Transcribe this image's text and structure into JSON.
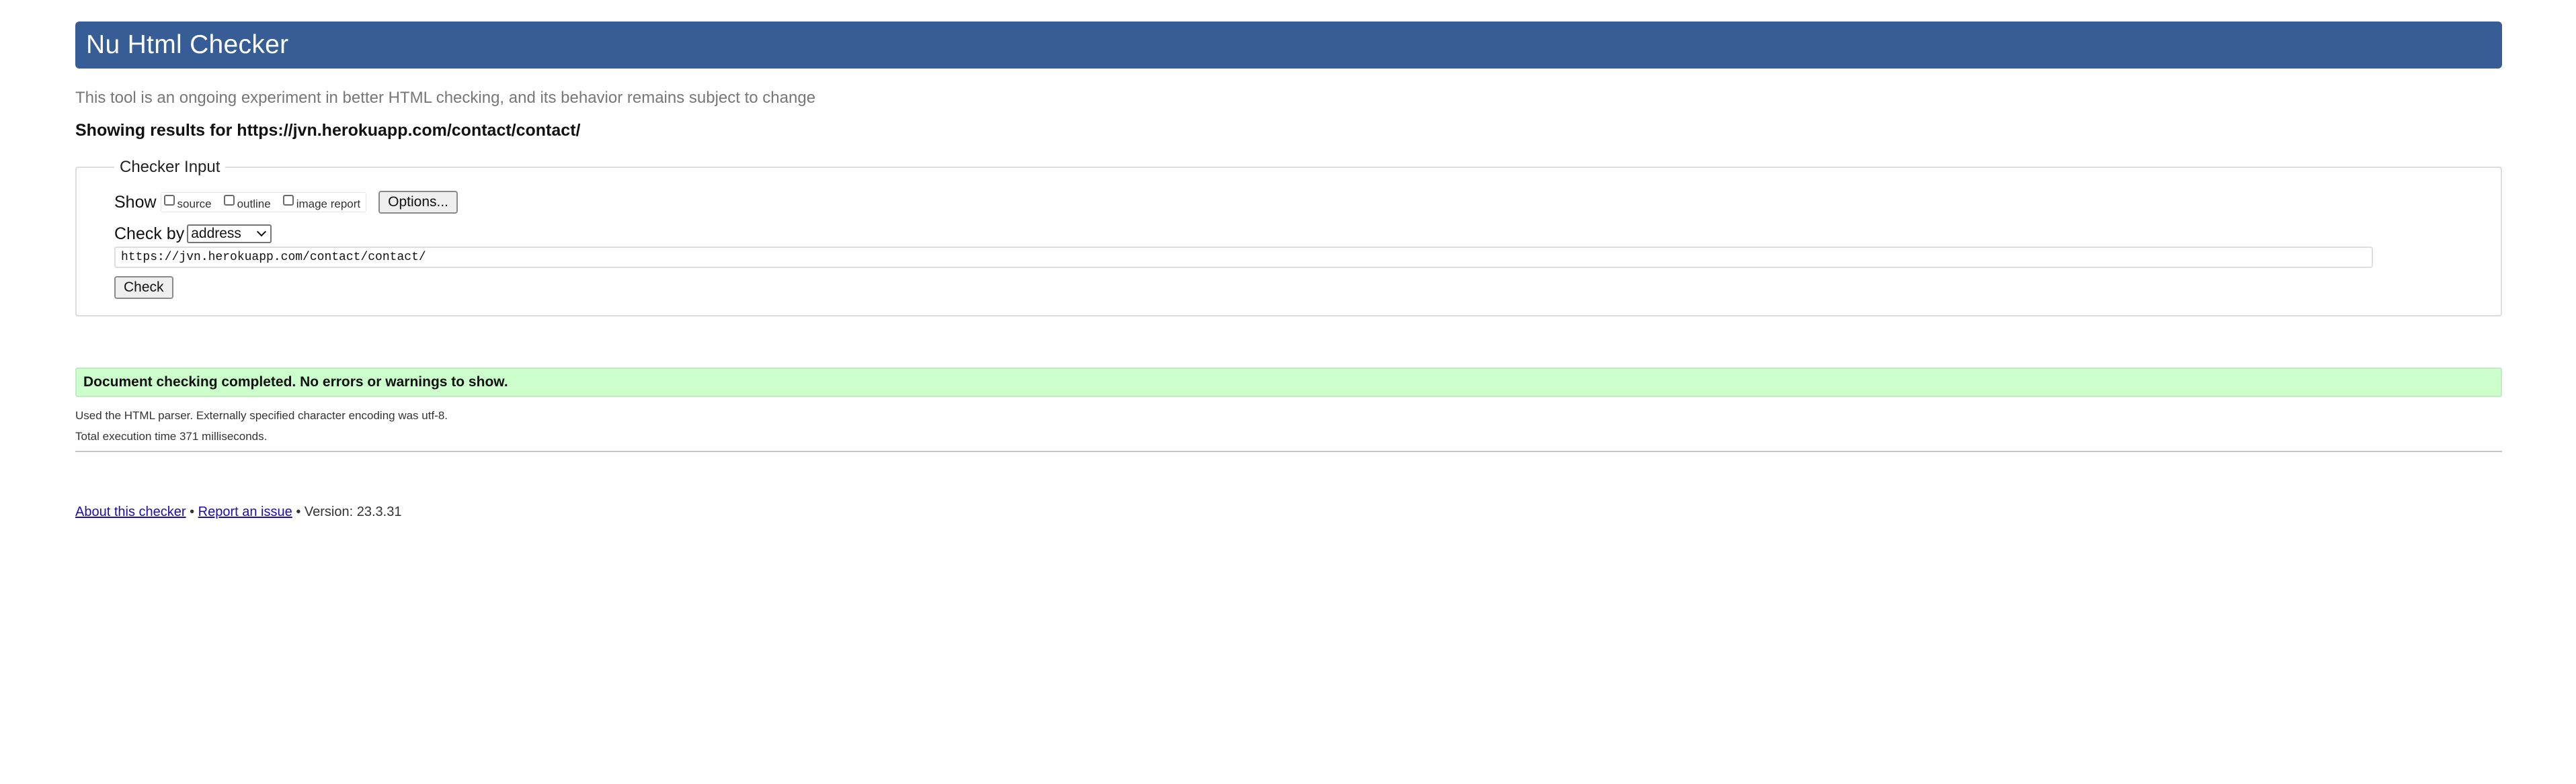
{
  "header": {
    "title": "Nu Html Checker",
    "color": "#365d95"
  },
  "tagline": "This tool is an ongoing experiment in better HTML checking, and its behavior remains subject to change",
  "showing": "Showing results for https://jvn.herokuapp.com/contact/contact/",
  "checker_input": {
    "legend": "Checker Input",
    "show_label": "Show",
    "show_options": [
      {
        "label": "source",
        "checked": false
      },
      {
        "label": "outline",
        "checked": false
      },
      {
        "label": "image report",
        "checked": false
      }
    ],
    "options_button": "Options...",
    "check_by_label": "Check by",
    "check_by_value": "address",
    "url_value": "https://jvn.herokuapp.com/contact/contact/",
    "check_button": "Check"
  },
  "result": {
    "message": "Document checking completed. No errors or warnings to show.",
    "color": "#ccffcc",
    "parser_info": "Used the HTML parser. Externally specified character encoding was utf-8.",
    "execution_time": "Total execution time 371 milliseconds."
  },
  "footer": {
    "about_link": "About this checker",
    "separator": "•",
    "report_link": "Report an issue",
    "version": "Version: 23.3.31"
  }
}
